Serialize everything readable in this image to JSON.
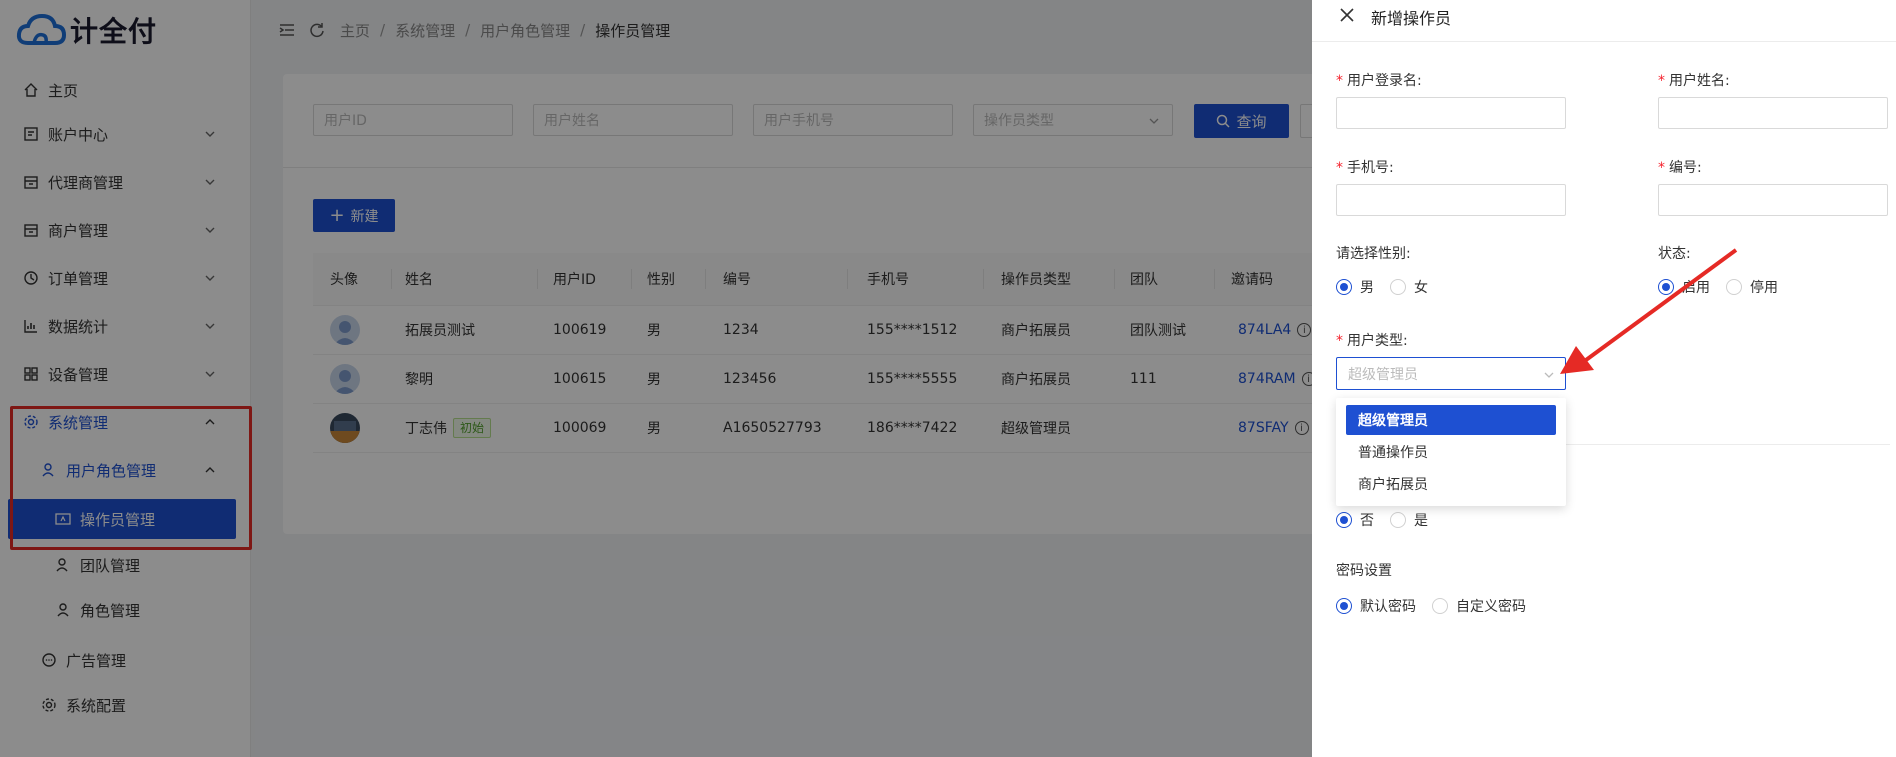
{
  "logo": {
    "text": "计全付"
  },
  "sidebar": {
    "items": [
      {
        "label": "主页",
        "icon": "home-icon"
      },
      {
        "label": "账户中心",
        "icon": "account-icon"
      },
      {
        "label": "代理商管理",
        "icon": "agent-icon"
      },
      {
        "label": "商户管理",
        "icon": "merchant-icon"
      },
      {
        "label": "订单管理",
        "icon": "order-icon"
      },
      {
        "label": "数据统计",
        "icon": "chart-icon"
      },
      {
        "label": "设备管理",
        "icon": "device-icon"
      },
      {
        "label": "系统管理",
        "icon": "gear-icon"
      },
      {
        "label": "用户角色管理",
        "icon": "users-icon"
      },
      {
        "label": "操作员管理",
        "icon": "operator-icon"
      },
      {
        "label": "团队管理",
        "icon": "team-icon"
      },
      {
        "label": "角色管理",
        "icon": "role-icon"
      },
      {
        "label": "广告管理",
        "icon": "ad-icon"
      },
      {
        "label": "系统配置",
        "icon": "settings-icon"
      }
    ]
  },
  "breadcrumb": {
    "items": [
      "主页",
      "系统管理",
      "用户角色管理",
      "操作员管理"
    ]
  },
  "filters": {
    "user_id_placeholder": "用户ID",
    "user_name_placeholder": "用户姓名",
    "user_phone_placeholder": "用户手机号",
    "operator_type_placeholder": "操作员类型",
    "query_label": "查询"
  },
  "new_button": {
    "label": "新建"
  },
  "table": {
    "columns": [
      "头像",
      "姓名",
      "用户ID",
      "性别",
      "编号",
      "手机号",
      "操作员类型",
      "团队",
      "邀请码"
    ],
    "rows": [
      {
        "name": "拓展员测试",
        "tag": "",
        "user_id": "100619",
        "gender": "男",
        "code": "1234",
        "phone": "155****1512",
        "type": "商户拓展员",
        "team": "团队测试",
        "invite": "874LA4"
      },
      {
        "name": "黎明",
        "tag": "",
        "user_id": "100615",
        "gender": "男",
        "code": "123456",
        "phone": "155****5555",
        "type": "商户拓展员",
        "team": "111",
        "invite": "874RAM"
      },
      {
        "name": "丁志伟",
        "tag": "初始",
        "user_id": "100069",
        "gender": "男",
        "code": "A1650527793",
        "phone": "186****7422",
        "type": "超级管理员",
        "team": "",
        "invite": "87SFAY"
      }
    ]
  },
  "drawer": {
    "title": "新增操作员",
    "login_name_label": "用户登录名:",
    "real_name_label": "用户姓名:",
    "phone_label": "手机号:",
    "code_label": "编号:",
    "gender_label": "请选择性别:",
    "gender_options": [
      "男",
      "女"
    ],
    "status_label": "状态:",
    "status_options": [
      "启用",
      "停用"
    ],
    "user_type_label": "用户类型:",
    "user_type_placeholder": "超级管理员",
    "user_type_options": [
      "超级管理员",
      "普通操作员",
      "商户拓展员"
    ],
    "yesno_options": [
      "否",
      "是"
    ],
    "password_label": "密码设置",
    "password_options": [
      "默认密码",
      "自定义密码"
    ],
    "required_mark": "*"
  },
  "colors": {
    "primary": "#1e50d2",
    "annotation_red": "#e52a25"
  }
}
